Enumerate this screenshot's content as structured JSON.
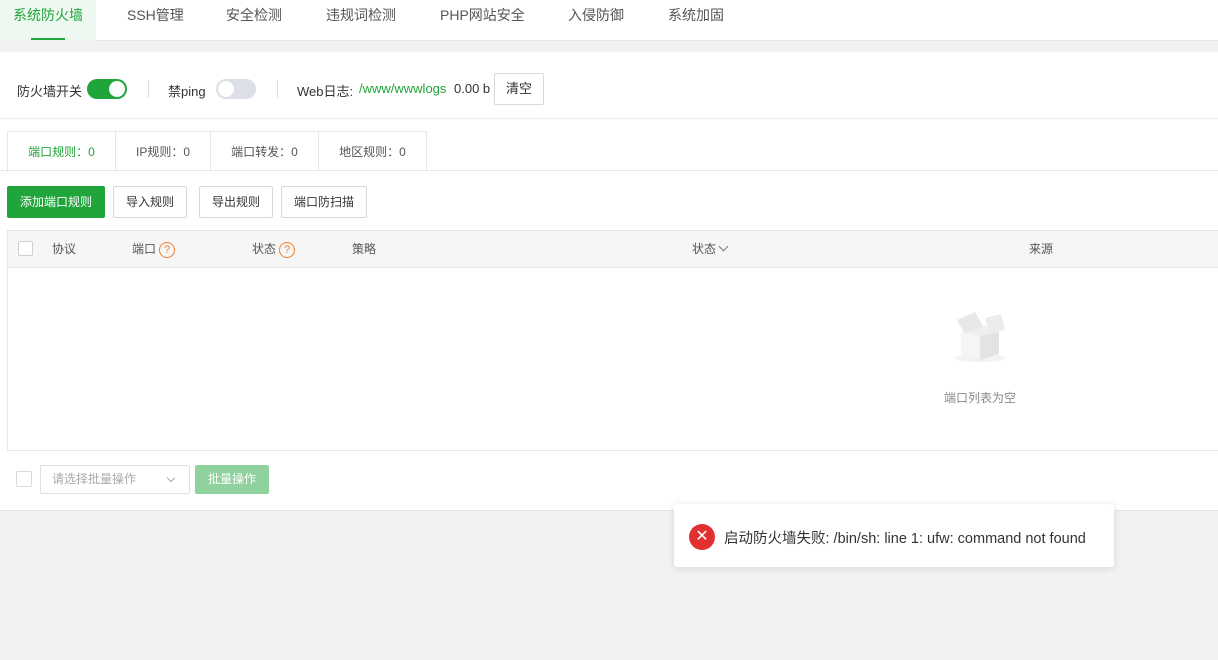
{
  "top_tabs": [
    {
      "label": "系统防火墙"
    },
    {
      "label": "SSH管理"
    },
    {
      "label": "安全检测"
    },
    {
      "label": "违规词检测"
    },
    {
      "label": "PHP网站安全"
    },
    {
      "label": "入侵防御"
    },
    {
      "label": "系统加固"
    }
  ],
  "toolbar": {
    "firewall_label": "防火墙开关",
    "firewall_on": true,
    "ping_label": "禁ping",
    "ping_on": false,
    "weblog_label": "Web日志:",
    "weblog_path": "/www/wwwlogs",
    "weblog_size": "0.00 b",
    "clear_label": "清空"
  },
  "sub_tabs": [
    {
      "label": "端口规则：0"
    },
    {
      "label": "IP规则：0"
    },
    {
      "label": "端口转发：0"
    },
    {
      "label": "地区规则：0"
    }
  ],
  "actions": {
    "add": "添加端口规则",
    "import": "导入规则",
    "export": "导出规则",
    "scan": "端口防扫描"
  },
  "table": {
    "headers": {
      "protocol": "协议",
      "port": "端口",
      "status": "状态",
      "policy": "策略",
      "status2": "状态",
      "source": "来源"
    },
    "help_glyph": "?",
    "empty_text": "端口列表为空"
  },
  "footer": {
    "select_placeholder": "请选择批量操作",
    "batch_label": "批量操作"
  },
  "toast": {
    "icon": "✕",
    "message": "启动防火墙失败: /bin/sh: line 1: ufw: command not found"
  },
  "colors": {
    "accent": "#20a53a",
    "error": "#e03030",
    "help": "#f0822e"
  }
}
